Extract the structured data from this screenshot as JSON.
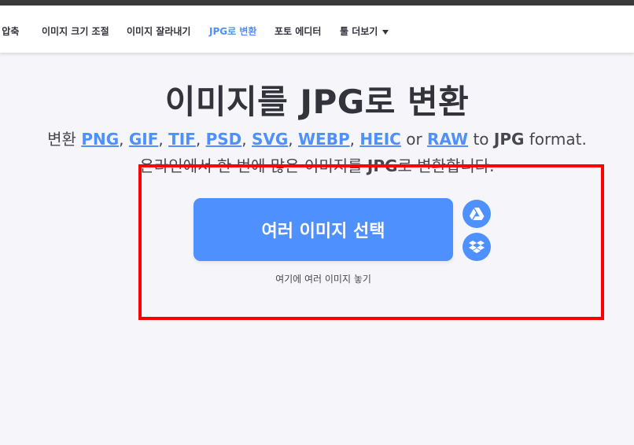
{
  "nav": {
    "items": [
      {
        "label": "이미지 압축",
        "active": false
      },
      {
        "label": "이미지 크기 조절",
        "active": false
      },
      {
        "label": "이미지 잘라내기",
        "active": false
      },
      {
        "label": "JPG로 변환",
        "active": true
      },
      {
        "label": "포토 에디터",
        "active": false
      },
      {
        "label": "툴 더보기",
        "active": false
      }
    ]
  },
  "hero": {
    "title": "이미지를 JPG로 변환",
    "subtitle": {
      "prefix": "변환",
      "formats": [
        "PNG",
        "GIF",
        "TIF",
        "PSD",
        "SVG",
        "WEBP",
        "HEIC"
      ],
      "or": "or",
      "last_format": "RAW",
      "to": "to",
      "target": "JPG",
      "suffix": "format."
    },
    "subtitle2": {
      "pre": "온라인에서 한 번에 많은 이미지를",
      "bold": "JPG",
      "post": "로 변환합니다."
    }
  },
  "upload": {
    "select_label": "여러 이미지 선택",
    "drop_hint": "여기에 여러 이미지 놓기",
    "google_drive_icon": "google-drive-icon",
    "dropbox_icon": "dropbox-icon"
  },
  "colors": {
    "accent": "#4d90fe",
    "text": "#33333b",
    "background": "#f5f5fa",
    "highlight": "#ff0000"
  }
}
